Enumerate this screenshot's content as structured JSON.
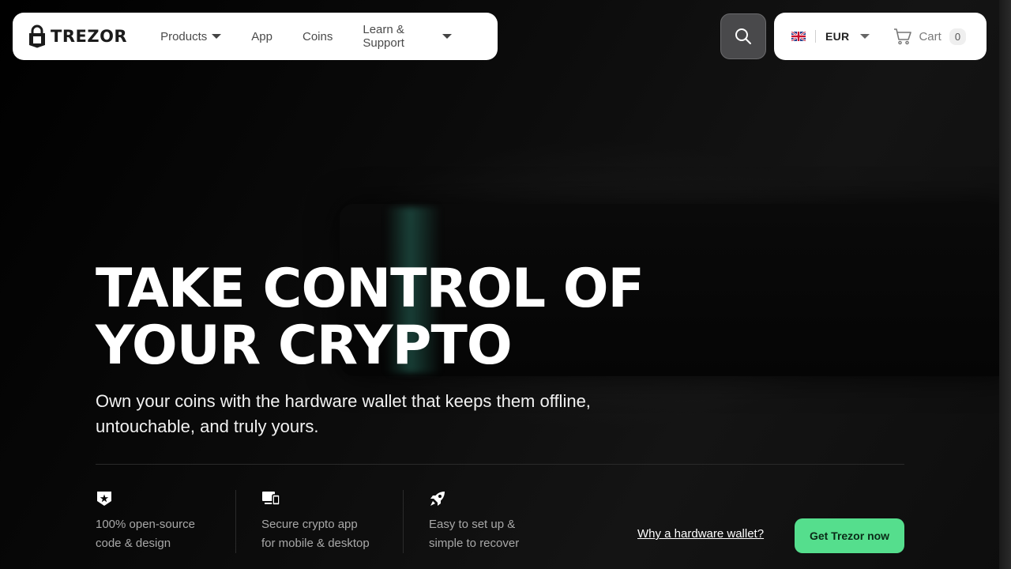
{
  "brand": {
    "name": "TREZOR"
  },
  "nav": {
    "items": [
      {
        "label": "Products",
        "has_dropdown": true
      },
      {
        "label": "App",
        "has_dropdown": false
      },
      {
        "label": "Coins",
        "has_dropdown": false
      },
      {
        "label": "Learn & Support",
        "has_dropdown": true
      }
    ]
  },
  "header_right": {
    "currency": "EUR",
    "language_flag": "uk-flag-icon",
    "cart_label": "Cart",
    "cart_count": "0"
  },
  "hero": {
    "headline_line1": "TAKE CONTROL OF",
    "headline_line2": "YOUR CRYPTO",
    "subhead": "Own your coins with the hardware wallet that keeps them offline, untouchable, and truly yours."
  },
  "features": [
    {
      "icon": "shield-star-icon",
      "line1": "100% open-source",
      "line2": "code & design"
    },
    {
      "icon": "devices-icon",
      "line1": "Secure crypto app",
      "line2": "for mobile & desktop"
    },
    {
      "icon": "rocket-icon",
      "line1": "Easy to set up &",
      "line2": "simple to recover"
    }
  ],
  "actions": {
    "why_link": "Why a hardware wallet?",
    "cta": "Get Trezor now"
  },
  "colors": {
    "cta_bg": "#55de8d",
    "background": "#050505"
  }
}
